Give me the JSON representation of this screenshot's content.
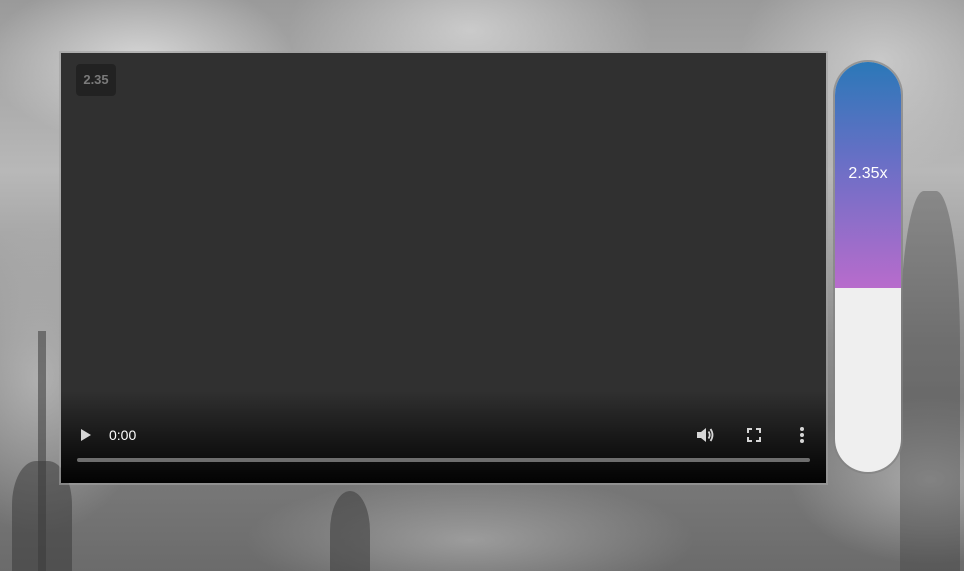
{
  "video": {
    "speed_overlay": "2.35",
    "current_time": "0:00",
    "progress": 0
  },
  "speed_control": {
    "label": "2.35x",
    "fill_fraction": 0.55
  },
  "icons": {
    "play": "play-icon",
    "volume": "volume-icon",
    "fullscreen": "fullscreen-icon",
    "more": "more-vertical-icon"
  },
  "colors": {
    "player_bg": "#303030",
    "fill_top": "#2b78b8",
    "fill_bottom": "#b86ccc",
    "slider_bg": "#efefef"
  }
}
